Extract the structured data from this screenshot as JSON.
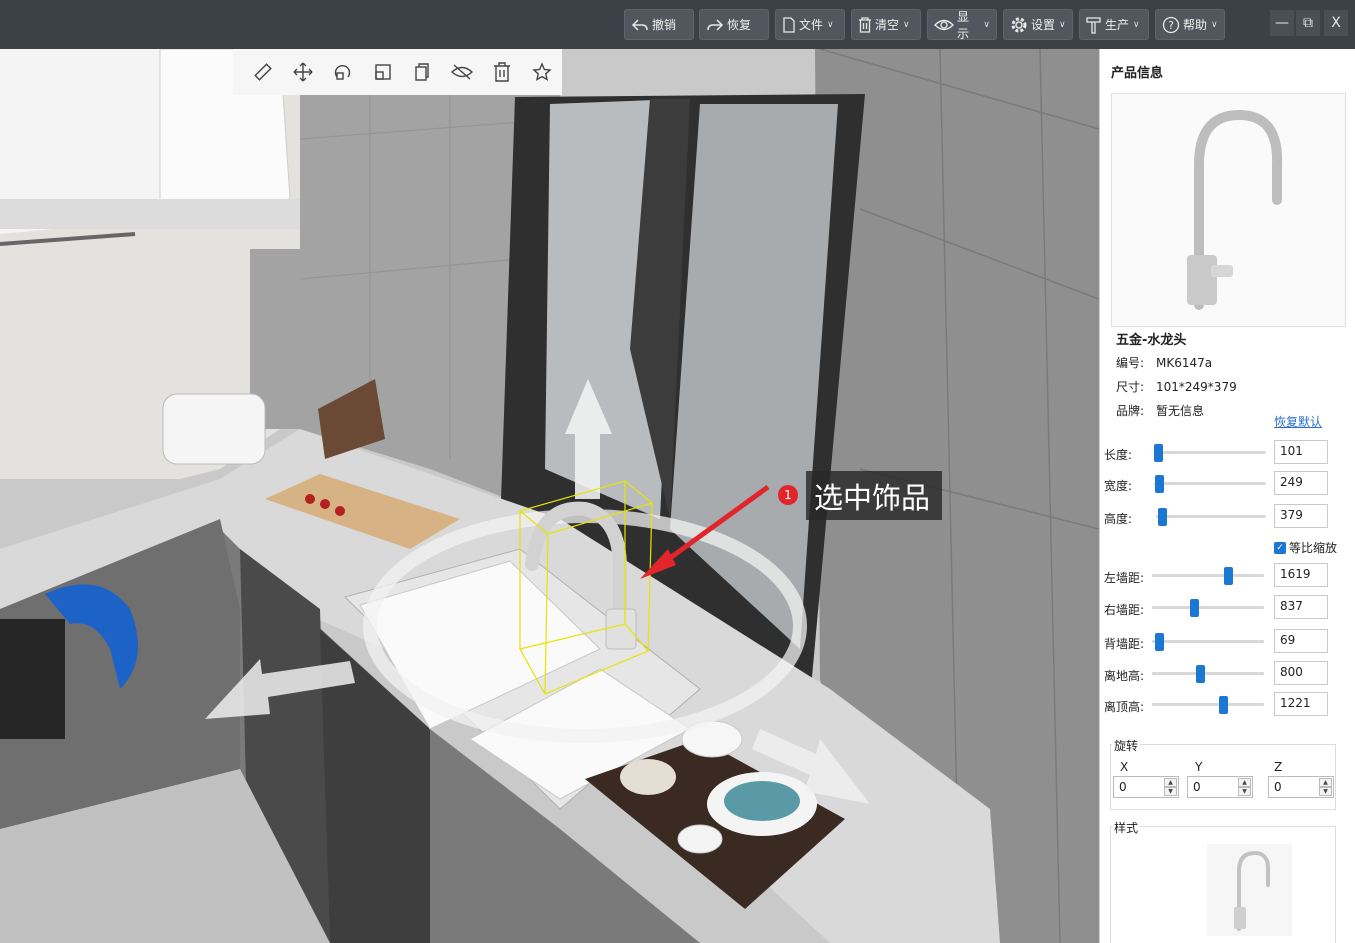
{
  "toolbar": {
    "undo": "撤销",
    "redo": "恢复",
    "file": "文件",
    "clear": "清空",
    "display": "显示",
    "settings": "设置",
    "production": "生产",
    "help": "帮助"
  },
  "window": {
    "minimize": "—",
    "restore": "⧉",
    "close": "X"
  },
  "annotation": {
    "badge": "1",
    "text": "选中饰品"
  },
  "panel": {
    "title": "产品信息",
    "product_name": "五金-水龙头",
    "code_label": "编号:",
    "code_value": "MK6147a",
    "size_label": "尺寸:",
    "size_value": "101*249*379",
    "brand_label": "品牌:",
    "brand_value": "暂无信息",
    "restore_default": "恢复默认",
    "length_label": "长度:",
    "length_value": "101",
    "width_label": "宽度:",
    "width_value": "249",
    "height_label": "高度:",
    "height_value": "379",
    "proportional_label": "等比缩放",
    "left_wall_label": "左墙距:",
    "left_wall_value": "1619",
    "right_wall_label": "右墙距:",
    "right_wall_value": "837",
    "back_wall_label": "背墙距:",
    "back_wall_value": "69",
    "floor_label": "离地高:",
    "floor_value": "800",
    "ceiling_label": "离顶高:",
    "ceiling_value": "1221",
    "rotation_title": "旋转",
    "rot_x_label": "X",
    "rot_x_value": "0",
    "rot_y_label": "Y",
    "rot_y_value": "0",
    "rot_z_label": "Z",
    "rot_z_value": "0",
    "style_title": "样式"
  },
  "sliders": {
    "length": 0.0,
    "width": 0.01,
    "height": 0.02,
    "left_wall": 0.7,
    "right_wall": 0.37,
    "back_wall": 0.03,
    "floor": 0.43,
    "ceiling": 0.65
  },
  "colors": {
    "accent": "#1a77d2",
    "titlebar": "#3c4047",
    "selection": "#e5e500",
    "arrow": "#e0262b"
  }
}
